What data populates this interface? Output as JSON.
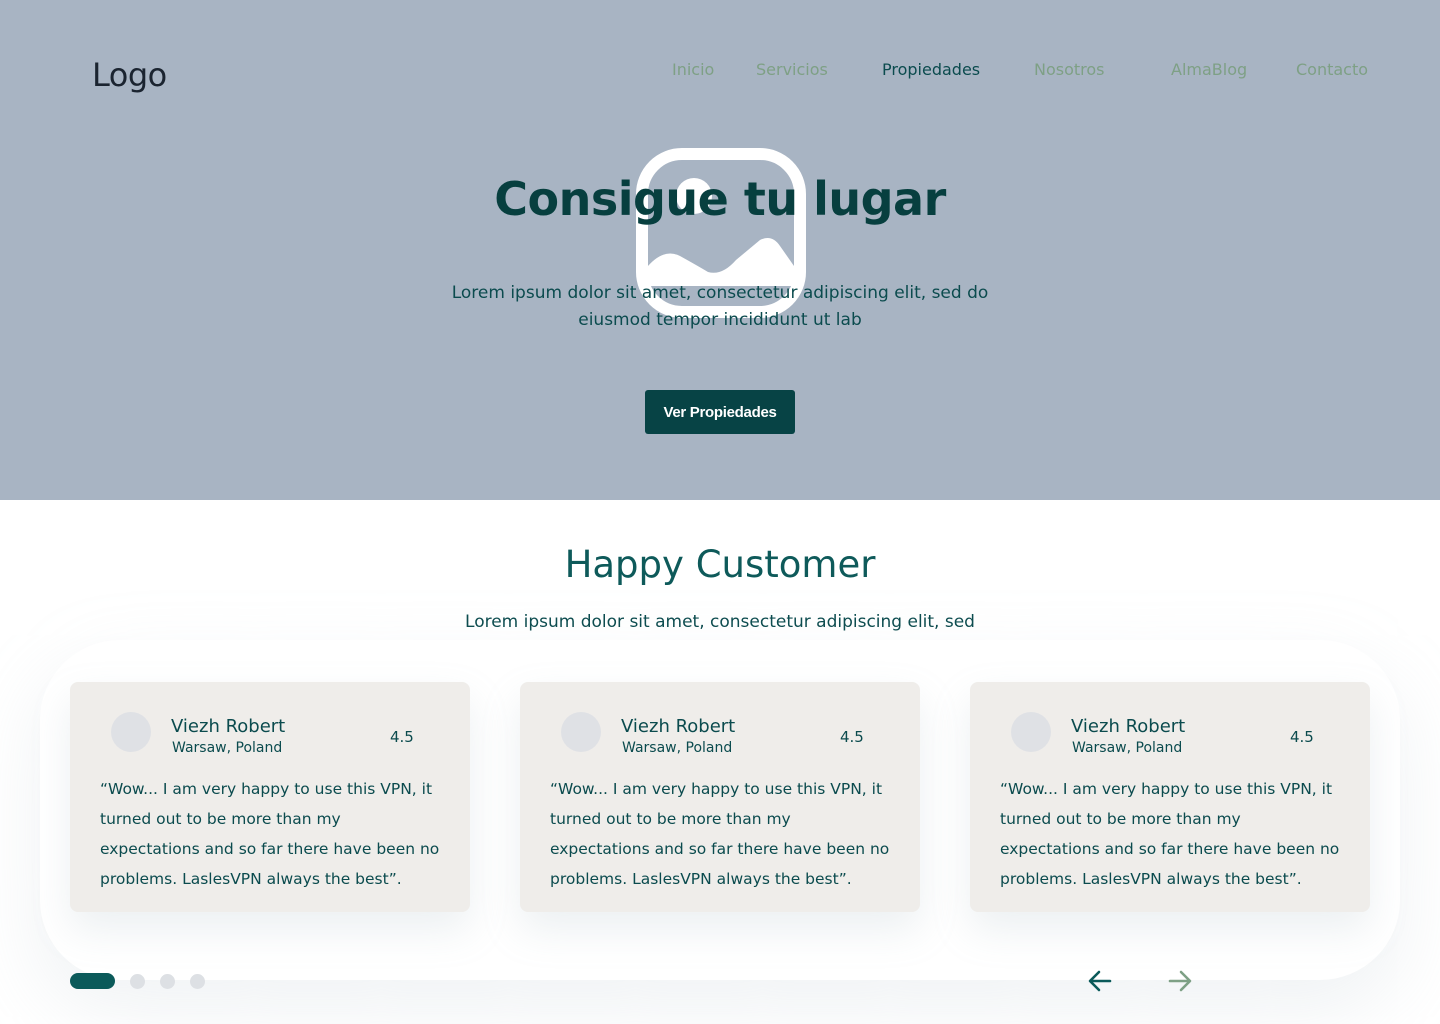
{
  "header": {
    "logo": "Logo",
    "nav": [
      {
        "label": "Inicio"
      },
      {
        "label": "Servicios"
      },
      {
        "label": "Propiedades",
        "active": true
      },
      {
        "label": "Nosotros"
      },
      {
        "label": "AlmaBlog"
      },
      {
        "label": "Contacto"
      }
    ]
  },
  "hero": {
    "image_icon": "image-placeholder-icon",
    "title": "Consigue tu lugar",
    "subtitle": "Lorem ipsum dolor sit amet, consectetur adipiscing elit, sed do eiusmod tempor incididunt ut lab",
    "button_label": "Ver Propiedades"
  },
  "testimonials": {
    "title": "Happy Customer",
    "subtitle": "Lorem ipsum dolor sit amet, consectetur adipiscing elit, sed",
    "cards": [
      {
        "name": "Viezh Robert",
        "location": "Warsaw, Poland",
        "rating": "4.5",
        "quote": "“Wow... I am very happy to use this VPN, it turned out to be more than my expectations and so far there have been no problems. LaslesVPN always the best”."
      },
      {
        "name": "Viezh Robert",
        "location": "Warsaw, Poland",
        "rating": "4.5",
        "quote": "“Wow... I am very happy to use this VPN, it turned out to be more than my expectations and so far there have been no problems. LaslesVPN always the best”."
      },
      {
        "name": "Viezh Robert",
        "location": "Warsaw, Poland",
        "rating": "4.5",
        "quote": "“Wow... I am very happy to use this VPN, it turned out to be more than my expectations and so far there have been no problems. LaslesVPN always the best”."
      }
    ],
    "pagination": {
      "total": 4,
      "active": 1
    },
    "prev_icon": "arrow-left-icon",
    "next_icon": "arrow-right-icon"
  },
  "colors": {
    "hero_bg": "#a8b4c3",
    "primary": "#074345",
    "text": "#0b4b4e",
    "nav_inactive": "#7ea085",
    "card_bg": "#efedea"
  }
}
